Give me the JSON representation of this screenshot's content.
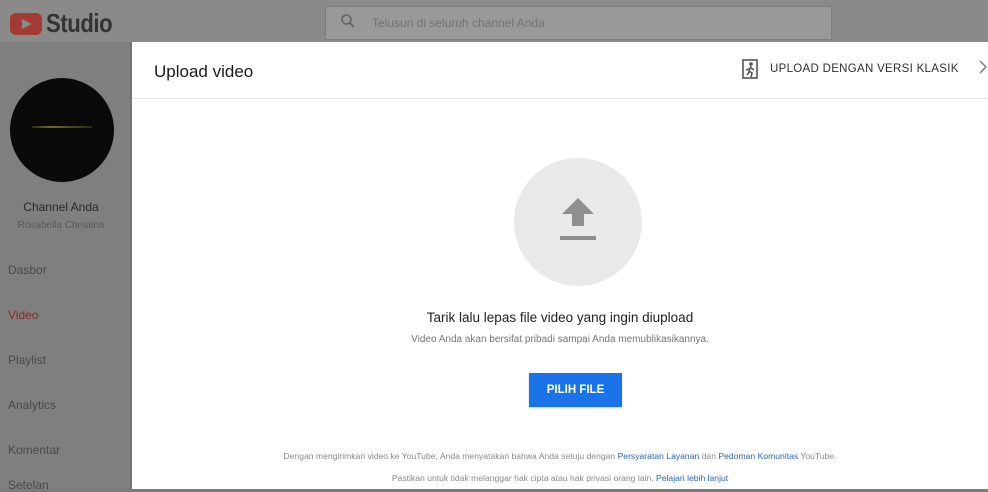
{
  "app": {
    "logo_text": "Studio",
    "search_placeholder": "Telusuri di seluruh channel Anda"
  },
  "sidebar": {
    "channel_name": "Channel Anda",
    "channel_owner": "Rosabella Christina",
    "items": [
      {
        "label": "Dasbor",
        "active": false
      },
      {
        "label": "Video",
        "active": true
      },
      {
        "label": "Playlist",
        "active": false
      },
      {
        "label": "Analytics",
        "active": false
      },
      {
        "label": "Komentar",
        "active": false
      },
      {
        "label": "Setelan",
        "active": false
      }
    ]
  },
  "dialog": {
    "title": "Upload video",
    "classic_label": "UPLOAD DENGAN VERSI KLASIK",
    "drop_text": "Tarik lalu lepas file video yang ingin diupload",
    "privacy_note": "Video Anda akan bersifat pribadi sampai Anda memublikasikannya.",
    "pick_file_label": "PILIH FILE",
    "terms": {
      "prefix": "Dengan mengirimkan video ke YouTube, Anda menyatakan bahwa Anda setuju dengan ",
      "tos_link": "Persyaratan Layanan",
      "middle": " dan ",
      "guidelines_link": "Pedoman Komunitas",
      "suffix": " YouTube."
    },
    "copyright": {
      "prefix": "Pastikan untuk tidak melanggar hak cipta atau hak privasi orang lain. ",
      "learn_more_link": "Pelajari lebih lanjut"
    }
  },
  "colors": {
    "accent": "#1a73e8",
    "link": "#2a63c8",
    "brand_red": "#ff0000"
  }
}
